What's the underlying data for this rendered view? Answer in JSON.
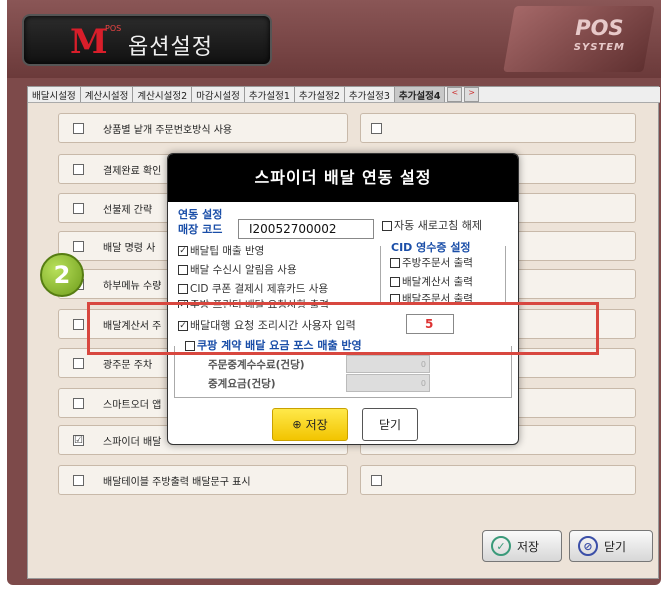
{
  "window": {
    "title": "옵션설정",
    "logo": "M",
    "logo_sup": "POS",
    "pos_logo": "POS",
    "pos_sub": "SYSTEM"
  },
  "tabs": [
    "배달시설정",
    "계산시설정",
    "계산시설정2",
    "마감시설정",
    "추가설정1",
    "추가설정2",
    "추가설정3",
    "추가설정4"
  ],
  "tab_arrows": [
    "<",
    ">"
  ],
  "rows": [
    {
      "label": "상품별 낱개 주문번호방식 사용",
      "checked": false
    },
    {
      "label": "결제완료 확인",
      "checked": false
    },
    {
      "label": "선불제 간략",
      "checked": false
    },
    {
      "label": "배달 명령 사",
      "checked": false
    },
    {
      "label": "하부메뉴 수량",
      "checked": false
    },
    {
      "label": "배달계산서 주",
      "checked": false
    },
    {
      "label": "광주문 주차",
      "checked": false
    },
    {
      "label": "스마트오더 앱",
      "checked": false
    },
    {
      "label": "스파이더 배달",
      "checked": true
    },
    {
      "label": "배달테이블 주방출력 배달문구 표시",
      "checked": false
    }
  ],
  "badge": "2",
  "footer": {
    "save": "저장",
    "close": "닫기"
  },
  "modal": {
    "title": "스파이더 배달 연동 설정",
    "group1": "연동 설정",
    "store_code_label": "매장 코드",
    "store_code": "I20052700002",
    "auto_refresh": "자동 새로고침 해제",
    "opt1": "배달팁 매출 반영",
    "opt2": "배달 수신시 알림음 사용",
    "opt3": "CID 쿠폰 결제시 제휴카드 사용",
    "opt4": "주방 프린터 배달 요청사항 출력",
    "opt5": "배달대행 요청 조리시간 사용자 입력",
    "opt5_value": "5",
    "cid_group": "CID 영수증 설정",
    "cid1": "주방주문서 출력",
    "cid2": "배달계산서 출력",
    "cid3": "배달주문서 출력",
    "coupang": "쿠팡 계약 배달 요금 포스 매출 반영",
    "fee1": "주문중계수수료(건당)",
    "fee2": "중계요금(건당)",
    "fee_values": [
      "0",
      "0"
    ],
    "save": "저장",
    "close": "닫기"
  }
}
